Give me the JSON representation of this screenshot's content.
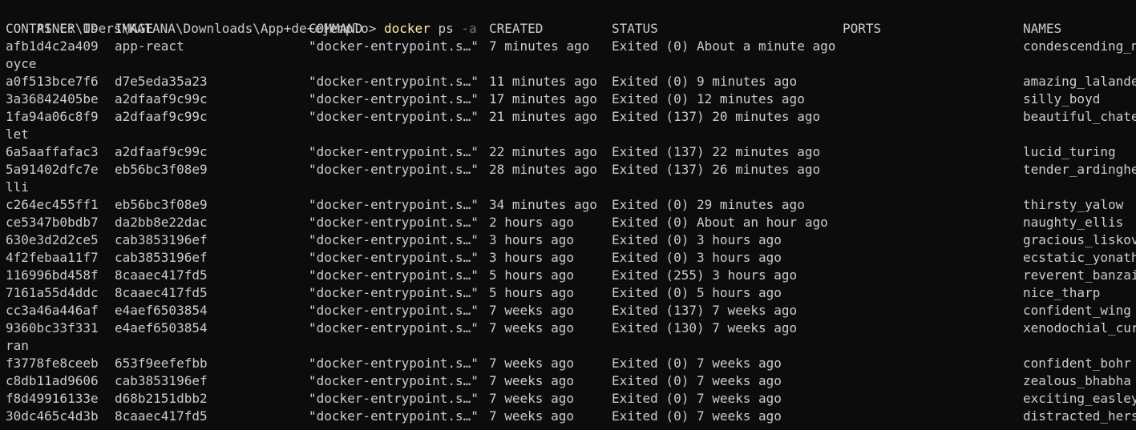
{
  "prompt": {
    "path": "PS C:\\Users\\KATANA\\Downloads\\App+de+ejemplo> ",
    "command": "docker",
    "args": " ps",
    "flag": " -a"
  },
  "colors": {
    "background": "#0c0c0c",
    "text": "#cccccc",
    "command": "#f9f1a5",
    "flag": "#767676"
  },
  "headers": [
    "CONTAINER ID",
    "IMAGE",
    "COMMAND",
    "CREATED",
    "STATUS",
    "PORTS",
    "NAMES"
  ],
  "rows": [
    {
      "id": "afb1d4c2a409",
      "image": "app-react",
      "command": "\"docker-entrypoint.s…\"",
      "created": "7 minutes ago",
      "status": "Exited (0) About a minute ago",
      "name": "condescending_n",
      "wrap": "oyce"
    },
    {
      "id": "a0f513bce7f6",
      "image": "d7e5eda35a23",
      "command": "\"docker-entrypoint.s…\"",
      "created": "11 minutes ago",
      "status": "Exited (0) 9 minutes ago",
      "name": "amazing_lalande"
    },
    {
      "id": "3a36842405be",
      "image": "a2dfaaf9c99c",
      "command": "\"docker-entrypoint.s…\"",
      "created": "17 minutes ago",
      "status": "Exited (0) 12 minutes ago",
      "name": "silly_boyd"
    },
    {
      "id": "1fa94a06c8f9",
      "image": "a2dfaaf9c99c",
      "command": "\"docker-entrypoint.s…\"",
      "created": "21 minutes ago",
      "status": "Exited (137) 20 minutes ago",
      "name": "beautiful_chate",
      "wrap": "let"
    },
    {
      "id": "6a5aaffafac3",
      "image": "a2dfaaf9c99c",
      "command": "\"docker-entrypoint.s…\"",
      "created": "22 minutes ago",
      "status": "Exited (137) 22 minutes ago",
      "name": "lucid_turing"
    },
    {
      "id": "5a91402dfc7e",
      "image": "eb56bc3f08e9",
      "command": "\"docker-entrypoint.s…\"",
      "created": "28 minutes ago",
      "status": "Exited (137) 26 minutes ago",
      "name": "tender_ardinghe",
      "wrap": "lli"
    },
    {
      "id": "c264ec455ff1",
      "image": "eb56bc3f08e9",
      "command": "\"docker-entrypoint.s…\"",
      "created": "34 minutes ago",
      "status": "Exited (0) 29 minutes ago",
      "name": "thirsty_yalow"
    },
    {
      "id": "ce5347b0bdb7",
      "image": "da2bb8e22dac",
      "command": "\"docker-entrypoint.s…\"",
      "created": "2 hours ago",
      "status": "Exited (0) About an hour ago",
      "name": "naughty_ellis"
    },
    {
      "id": "630e3d2d2ce5",
      "image": "cab3853196ef",
      "command": "\"docker-entrypoint.s…\"",
      "created": "3 hours ago",
      "status": "Exited (0) 3 hours ago",
      "name": "gracious_liskov"
    },
    {
      "id": "4f2febaa11f7",
      "image": "cab3853196ef",
      "command": "\"docker-entrypoint.s…\"",
      "created": "3 hours ago",
      "status": "Exited (0) 3 hours ago",
      "name": "ecstatic_yonath"
    },
    {
      "id": "116996bd458f",
      "image": "8caaec417fd5",
      "command": "\"docker-entrypoint.s…\"",
      "created": "5 hours ago",
      "status": "Exited (255) 3 hours ago",
      "name": "reverent_banzai"
    },
    {
      "id": "7161a55d4ddc",
      "image": "8caaec417fd5",
      "command": "\"docker-entrypoint.s…\"",
      "created": "5 hours ago",
      "status": "Exited (0) 5 hours ago",
      "name": "nice_tharp"
    },
    {
      "id": "cc3a46a446af",
      "image": "e4aef6503854",
      "command": "\"docker-entrypoint.s…\"",
      "created": "7 weeks ago",
      "status": "Exited (137) 7 weeks ago",
      "name": "confident_wing"
    },
    {
      "id": "9360bc33f331",
      "image": "e4aef6503854",
      "command": "\"docker-entrypoint.s…\"",
      "created": "7 weeks ago",
      "status": "Exited (130) 7 weeks ago",
      "name": "xenodochial_cur",
      "wrap": "ran"
    },
    {
      "id": "f3778fe8ceeb",
      "image": "653f9eefefbb",
      "command": "\"docker-entrypoint.s…\"",
      "created": "7 weeks ago",
      "status": "Exited (0) 7 weeks ago",
      "name": "confident_bohr"
    },
    {
      "id": "c8db11ad9606",
      "image": "cab3853196ef",
      "command": "\"docker-entrypoint.s…\"",
      "created": "7 weeks ago",
      "status": "Exited (0) 7 weeks ago",
      "name": "zealous_bhabha"
    },
    {
      "id": "f8d49916133e",
      "image": "d68b2151dbb2",
      "command": "\"docker-entrypoint.s…\"",
      "created": "7 weeks ago",
      "status": "Exited (0) 7 weeks ago",
      "name": "exciting_easley"
    },
    {
      "id": "30dc465c4d3b",
      "image": "8caaec417fd5",
      "command": "\"docker-entrypoint.s…\"",
      "created": "7 weeks ago",
      "status": "Exited (0) 7 weeks ago",
      "name": "distracted_hers"
    }
  ]
}
